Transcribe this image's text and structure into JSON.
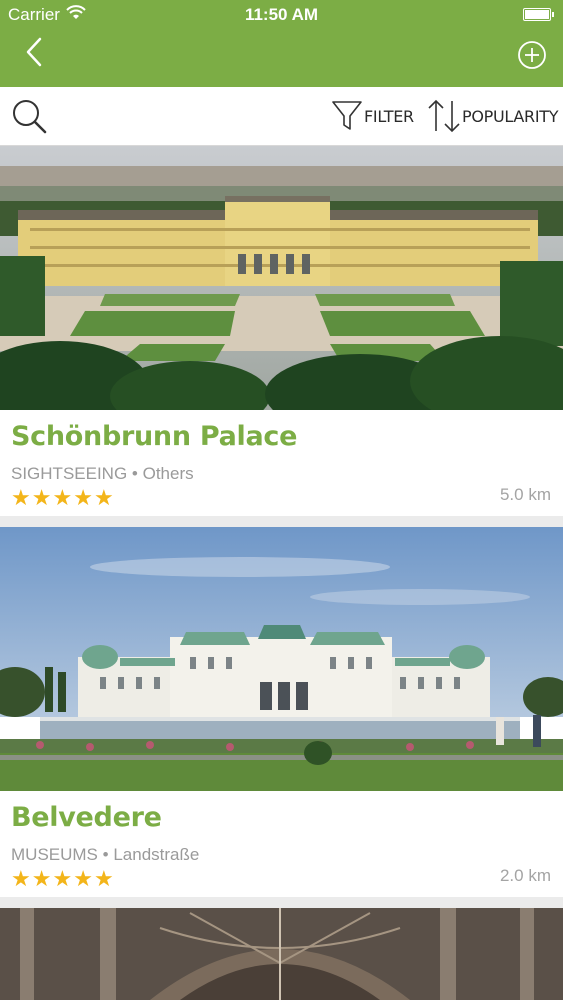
{
  "status_bar": {
    "carrier": "Carrier",
    "time": "11:50 AM"
  },
  "nav": {
    "back_icon": "chevron-left-icon",
    "add_icon": "plus-circle-icon",
    "bar_color": "#7cad45"
  },
  "toolbar": {
    "search_icon": "search-icon",
    "filter_label": "FILTER",
    "sort_label": "POPULARITY"
  },
  "places": [
    {
      "title": "Schönbrunn Palace",
      "category": "SIGHTSEEING",
      "area": "Others",
      "rating": 5,
      "distance": "5.0 km"
    },
    {
      "title": "Belvedere",
      "category": "MUSEUMS",
      "area": "Landstraße",
      "rating": 5,
      "distance": "2.0 km"
    }
  ],
  "colors": {
    "accent": "#7cad45",
    "star": "#f3b51a",
    "meta": "#9a9a9a"
  }
}
